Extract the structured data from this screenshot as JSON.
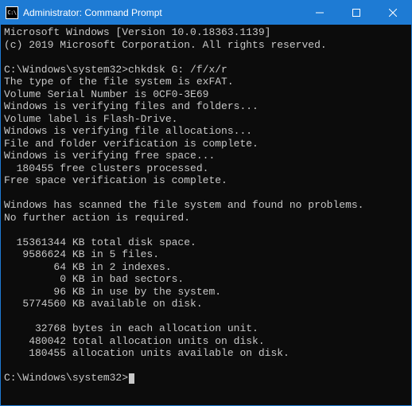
{
  "titlebar": {
    "icon_label": "C:\\",
    "title": "Administrator: Command Prompt"
  },
  "terminal": {
    "lines": [
      "Microsoft Windows [Version 10.0.18363.1139]",
      "(c) 2019 Microsoft Corporation. All rights reserved.",
      "",
      "C:\\Windows\\system32>chkdsk G: /f/x/r",
      "The type of the file system is exFAT.",
      "Volume Serial Number is 0CF0-3E69",
      "Windows is verifying files and folders...",
      "Volume label is Flash-Drive.",
      "Windows is verifying file allocations...",
      "File and folder verification is complete.",
      "Windows is verifying free space...",
      "  180455 free clusters processed.",
      "Free space verification is complete.",
      "",
      "Windows has scanned the file system and found no problems.",
      "No further action is required.",
      "",
      "  15361344 KB total disk space.",
      "   9586624 KB in 5 files.",
      "        64 KB in 2 indexes.",
      "         0 KB in bad sectors.",
      "        96 KB in use by the system.",
      "   5774560 KB available on disk.",
      "",
      "     32768 bytes in each allocation unit.",
      "    480042 total allocation units on disk.",
      "    180455 allocation units available on disk.",
      ""
    ],
    "prompt": "C:\\Windows\\system32>"
  }
}
